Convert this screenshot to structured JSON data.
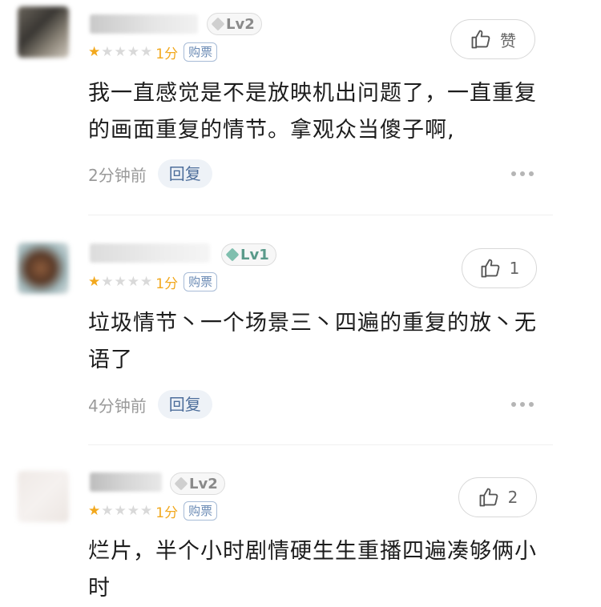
{
  "comments": [
    {
      "level": "Lv2",
      "score": "1分",
      "ticket": "购票",
      "like_label": "赞",
      "text": "我一直感觉是不是放映机出问题了，一直重复的画面重复的情节。拿观众当傻子啊,",
      "time": "2分钟前",
      "reply": "回复"
    },
    {
      "level": "Lv1",
      "score": "1分",
      "ticket": "购票",
      "like_label": "1",
      "text": "垃圾情节丶一个场景三丶四遍的重复的放丶无语了",
      "time": "4分钟前",
      "reply": "回复"
    },
    {
      "level": "Lv2",
      "score": "1分",
      "ticket": "购票",
      "like_label": "2",
      "text": "烂片，半个小时剧情硬生生重播四遍凑够俩小时"
    }
  ],
  "colors": {
    "star_on": "#f2a81d",
    "star_off": "#d9d9d9",
    "reply_text": "#4d6e9b",
    "ticket": "#6b8bb5"
  },
  "icons": {
    "like": "thumbs-up-icon",
    "more": "more-dots-icon",
    "level": "gem-icon"
  }
}
